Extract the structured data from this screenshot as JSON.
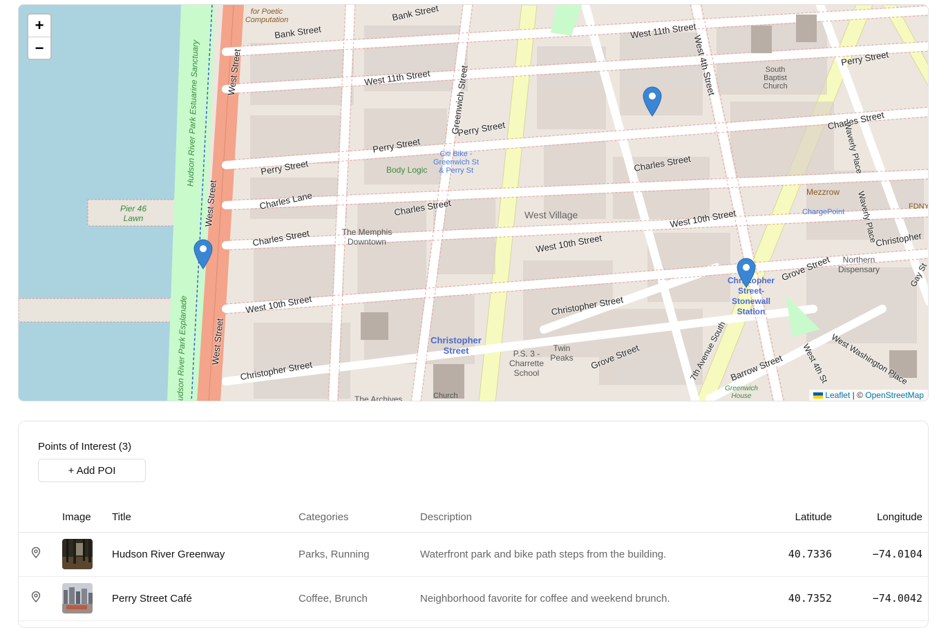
{
  "map": {
    "zoom_in_label": "+",
    "zoom_out_label": "−",
    "attribution": {
      "leaflet": "Leaflet",
      "separator": " | © ",
      "osm": "OpenStreetMap"
    },
    "colors": {
      "water": "#aad3df",
      "park": "#c8facc",
      "primary_road": "#f3a48a",
      "secondary_road": "#f7fabf",
      "marker": "#3a86d4"
    },
    "labels": {
      "bank_street": "Bank Street",
      "bank_street_2": "Bank Street",
      "west_11th": "West 11th Street",
      "west_11th_2": "West 11th Street",
      "perry_1": "Perry Street",
      "perry_2": "Perry Street",
      "perry_3": "Perry Street",
      "perry_4": "Perry Street",
      "charles_lane": "Charles Lane",
      "charles_1": "Charles Street",
      "charles_2": "Charles Street",
      "charles_3": "Charles Street",
      "charles_4": "Charles Street",
      "west_10th_1": "West 10th Street",
      "west_10th_2": "West 10th Street",
      "west_10th_3": "West 10th Street",
      "christopher_1": "Christopher Street",
      "christopher_2": "Christopher Street",
      "christopher_3": "Christopher",
      "west_street_1": "West Street",
      "west_street_2": "West Street",
      "west_street_3": "West Street",
      "greenwich_1": "Greenwich Street",
      "west_4th": "West 4th Street",
      "waverly": "Waverly Place",
      "waverly_2": "Waverly Place",
      "grove_1": "Grove Street",
      "grove_2": "Grove Street",
      "barrow": "Barrow Street",
      "seventh_ave": "7th Avenue South",
      "west_washington": "West Washington Place",
      "gay_st": "Gay St",
      "west_4th_2": "West 4th St",
      "west_village": "West Village",
      "memphis": "The Memphis Downtown",
      "twin_peaks": "Twin Peaks",
      "ps3": "P.S. 3 - Charrette School",
      "church": "Church",
      "south_baptist": "South Baptist Church",
      "northern_dispensary": "Northern Dispensary",
      "body_logic": "Body Logic",
      "citi_bike": "Citi Bike - Greenwich St & Perry St",
      "christopher_station": "Christopher Street-Stonewall Station",
      "christopher_street_stop": "Christopher Street",
      "mezzrow": "Mezzrow",
      "chargepoint": "ChargePoint",
      "pier46": "Pier 46 Lawn",
      "hudson_sanctuary": "Hudson River Park Estuarine Sanctuary",
      "hudson_esplanade": "udson River Park Esplanade",
      "poetic": "for Poetic Computation",
      "the_archives": "The Archives",
      "greenwich_house": "Greenwich House",
      "fdny": "FDNY"
    },
    "markers": [
      {
        "name": "marker-hudson-river-greenway"
      },
      {
        "name": "marker-perry-street-cafe"
      },
      {
        "name": "marker-christopher-station"
      }
    ]
  },
  "panel": {
    "title": "Points of Interest (3)",
    "add_button": "+ Add POI",
    "columns": {
      "image": "Image",
      "title": "Title",
      "categories": "Categories",
      "description": "Description",
      "latitude": "Latitude",
      "longitude": "Longitude"
    },
    "rows": [
      {
        "title": "Hudson River Greenway",
        "categories": "Parks, Running",
        "description": "Waterfront park and bike path steps from the building.",
        "latitude": "40.7336",
        "longitude": "−74.0104"
      },
      {
        "title": "Perry Street Café",
        "categories": "Coffee, Brunch",
        "description": "Neighborhood favorite for coffee and weekend brunch.",
        "latitude": "40.7352",
        "longitude": "−74.0042"
      }
    ]
  }
}
